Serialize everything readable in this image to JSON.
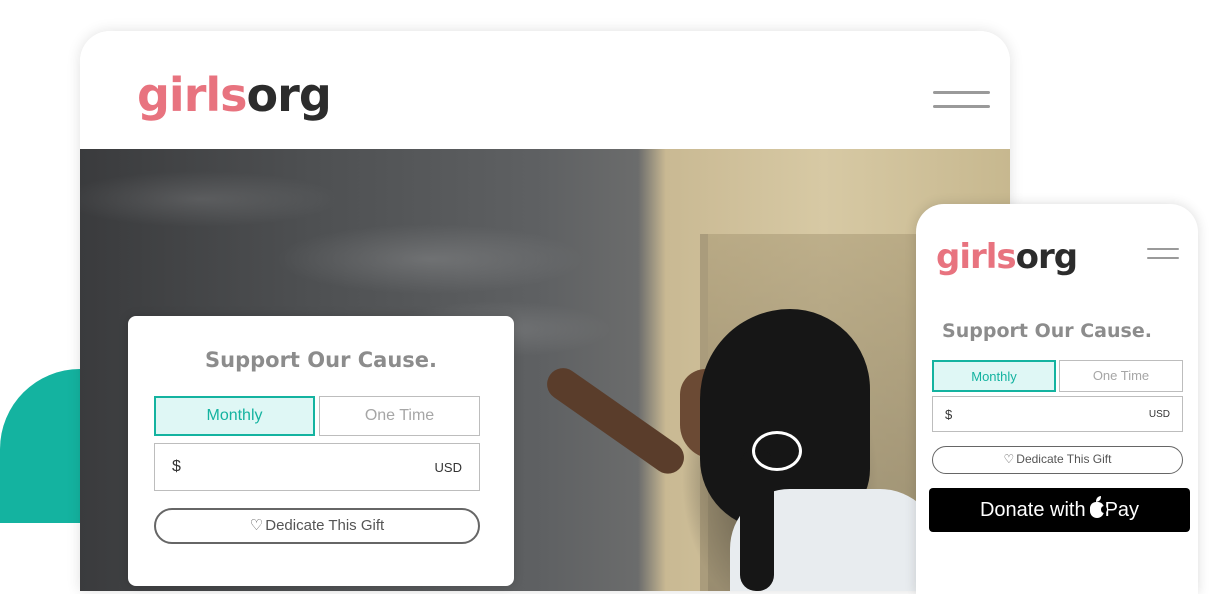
{
  "brand": {
    "logo_part1": "girls",
    "logo_part2": "org"
  },
  "colors": {
    "accent": "#14b3a0",
    "logo_pink": "#e8737f",
    "logo_dark": "#2c2c2c"
  },
  "desktop": {
    "donation": {
      "title": "Support Our Cause.",
      "tab_monthly": "Monthly",
      "tab_one_time": "One Time",
      "selected_tab": "Monthly",
      "currency_symbol": "$",
      "currency_code": "USD",
      "amount_value": "",
      "dedicate_label": "Dedicate This Gift",
      "dedicate_icon": "heart-icon"
    }
  },
  "mobile": {
    "donation": {
      "title": "Support Our Cause.",
      "tab_monthly": "Monthly",
      "tab_one_time": "One Time",
      "selected_tab": "Monthly",
      "currency_symbol": "$",
      "currency_code": "USD",
      "amount_value": "",
      "dedicate_label": "Dedicate This Gift",
      "dedicate_icon": "heart-icon",
      "apple_pay_prefix": "Donate with",
      "apple_pay_suffix": "Pay",
      "apple_pay_icon": "apple-icon"
    }
  }
}
